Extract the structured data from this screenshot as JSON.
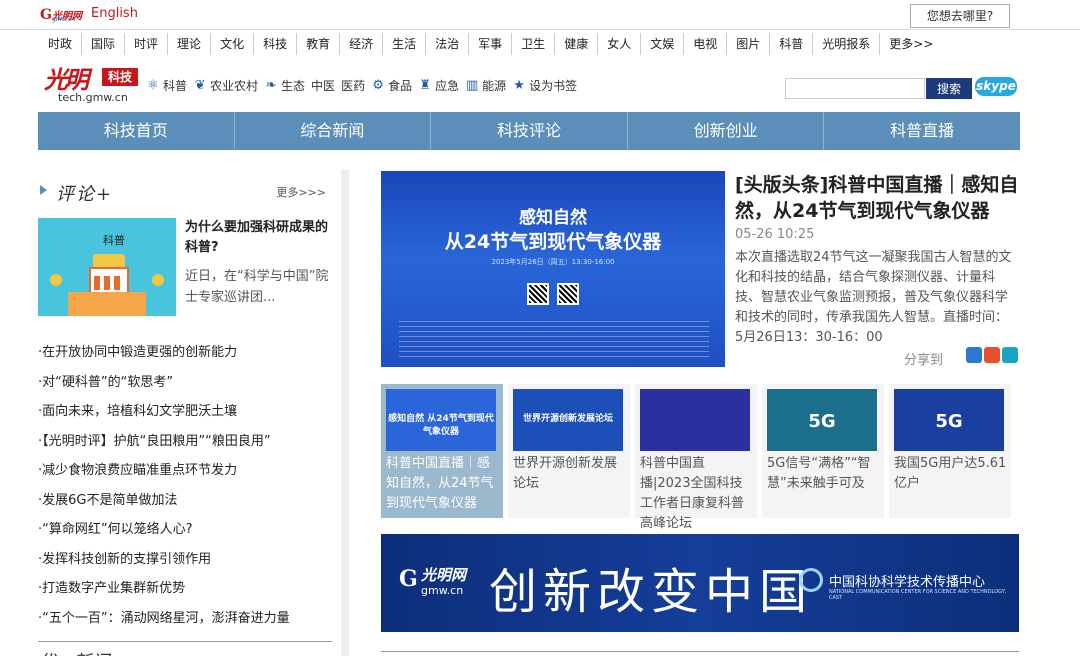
{
  "topbar": {
    "logo_g": "G",
    "logo_text": "光明网",
    "logo_sub": "gmw.cn",
    "english": "English",
    "where": "您想去哪里?"
  },
  "channels": [
    "时政",
    "国际",
    "时评",
    "理论",
    "文化",
    "科技",
    "教育",
    "经济",
    "生活",
    "法治",
    "军事",
    "卫生",
    "健康",
    "女人",
    "文娱",
    "电视",
    "图片",
    "科普",
    "光明报系",
    "更多>>"
  ],
  "header": {
    "logo_brand": "光明",
    "logo_badge": "科技",
    "logo_url": "tech.gmw.cn",
    "categories": [
      {
        "icon": "atom-icon",
        "glyph": "⚛",
        "label": "科普"
      },
      {
        "icon": "wheat-icon",
        "glyph": "❦",
        "label": "农业农村"
      },
      {
        "icon": "leaf-icon",
        "glyph": "❧",
        "label": "生态"
      },
      {
        "icon": "",
        "glyph": "",
        "label": "中医"
      },
      {
        "icon": "",
        "glyph": "",
        "label": "医药"
      },
      {
        "icon": "gear-icon",
        "glyph": "⚙",
        "label": "食品"
      },
      {
        "icon": "siren-icon",
        "glyph": "♜",
        "label": "应急"
      },
      {
        "icon": "factory-icon",
        "glyph": "▥",
        "label": "能源"
      },
      {
        "icon": "star-icon",
        "glyph": "★",
        "label": "设为书签"
      }
    ],
    "search_value": "",
    "search_button": "搜索",
    "skype": "skype"
  },
  "main_nav": [
    "科技首页",
    "综合新闻",
    "科技评论",
    "创新创业",
    "科普直播"
  ],
  "left": {
    "section_title": "评论+",
    "more": "更多>>>",
    "feature_title": "为什么要加强科研成果的科普?",
    "feature_desc": "近日，在“科学与中国”院士专家巡讲团...",
    "feature_img_label": "科普",
    "news": [
      "·在开放协同中锻造更强的创新能力",
      "·对“硬科普”的“软思考”",
      "·面向未来，培植科幻文学肥沃土壤",
      "·【光明时评】护航“良田粮用”“粮田良用”",
      "·减少食物浪费应瞄准重点环节发力",
      "·发展6G不是简单做加法",
      "·“算命网红”何以笼络人心?",
      "·发挥科技创新的支撑引领作用",
      "·打造数字产业集群新优势",
      "·“五个一百”：涌动网络星河，澎湃奋进力量"
    ],
    "partial_head": "优 · 新闻"
  },
  "headline": {
    "img_line1": "感知自然",
    "img_line2": "从24节气到现代气象仪器",
    "img_line3": "2023年5月26日（周五）13:30-16:00",
    "title": "[头版头条]科普中国直播｜感知自然，从24节气到现代气象仪器",
    "date": "05-26 10:25",
    "desc": "本次直播选取24节气这一凝聚我国古人智慧的文化和科技的结晶，结合气象探测仪器、计量科技、智慧农业气象监测预报，普及气象仪器科学和技术的同时，传承我国先人智慧。直播时间：5月26日13：30-16：00",
    "share": "分享到"
  },
  "thumbs": [
    {
      "caption": "科普中国直播｜感知自然，从24节气到现代气象仪器",
      "img_text": "感知自然 从24节气到现代气象仪器",
      "color": "#2a66d9"
    },
    {
      "caption": "世界开源创新发展论坛",
      "img_text": "世界开源创新发展论坛",
      "color": "#1d4fb8"
    },
    {
      "caption": "科普中国直播|2023全国科技工作者日康复科普高峰论坛",
      "img_text": "",
      "color": "#2b2fa0"
    },
    {
      "caption": "5G信号“满格”“智慧”未来触手可及",
      "img_text": "5G",
      "color": "#1b6e8c"
    },
    {
      "caption": "我国5G用户达5.61亿户",
      "img_text": "5G",
      "color": "#1a3f9e"
    }
  ],
  "banner": {
    "logo_g": "G",
    "logo_text": "光明网",
    "logo_sub": "gmw.cn",
    "main": "创新改变中国",
    "org_cn": "中国科协科学技术传播中心",
    "org_en": "NATIONAL COMMUNICATION CENTER FOR SCIENCE AND TECHNOLOGY, CAST"
  }
}
